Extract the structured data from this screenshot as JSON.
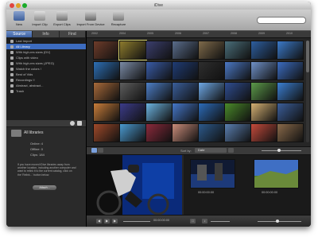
{
  "window": {
    "title": "iDive"
  },
  "toolbar": {
    "buttons": [
      {
        "label": "New"
      },
      {
        "label": "Import Clip"
      },
      {
        "label": "Export Clips"
      },
      {
        "label": "Import From Device"
      },
      {
        "label": "Recapture"
      }
    ],
    "search_placeholder": ""
  },
  "sidebar": {
    "tabs": [
      {
        "label": "Source"
      },
      {
        "label": "Info"
      },
      {
        "label": "Find"
      }
    ],
    "items": [
      {
        "label": "Last Import"
      },
      {
        "label": "All Library"
      },
      {
        "label": "With high-res sizes (DV)"
      },
      {
        "label": "Clips with video"
      },
      {
        "label": "With high-res sizes (JPEG)"
      },
      {
        "label": "Watch the colors !"
      },
      {
        "label": "Best of Vids"
      },
      {
        "label": "Recordings !!"
      },
      {
        "label": "Abstract, abstract..."
      },
      {
        "label": "Trash"
      }
    ],
    "info": {
      "title": "All libraries",
      "stats": [
        "Online: 4",
        "Offline: 0",
        "Clips: 184"
      ],
      "description": "If you have moved iDive libraries away from another location, including another computer and want to relink it to the current catalog, click on the 'Relink...' button below.",
      "button": "Attach..."
    }
  },
  "main": {
    "ruler_ticks": [
      "2002",
      "2004",
      "2005",
      "2006",
      "2007",
      "2008",
      "2009",
      "2010"
    ],
    "sort_label": "Sort by:",
    "sort_value": "Date",
    "timecodes": [
      "00:00:00:00",
      "00:00:00:00"
    ],
    "player_timecode": "00:00:00:00"
  },
  "thumb_colors": [
    "#6e3c2a",
    "#8d7b2d",
    "#3b3f6e",
    "#5a6d8c",
    "#7e6a4a",
    "#4a6e7a",
    "#2d5ea0",
    "#3b7ac9",
    "#2d6fb5",
    "#7a8aa5",
    "#395ca8",
    "#1f3c75",
    "#2e2e2e",
    "#4b78c4",
    "#6f91c8",
    "#3b6cc0",
    "#a86a3a",
    "#5e5e5e",
    "#4d7fc6",
    "#3a5e9a",
    "#6ea8e6",
    "#2f4d91",
    "#5c9a4a",
    "#3b7fd1",
    "#c87d3a",
    "#3c3c8a",
    "#6cb3e0",
    "#4577c8",
    "#2c6bb8",
    "#4a8a2a",
    "#d4b073",
    "#3b5e9a",
    "#a04a2a",
    "#4b9ad0",
    "#8c2a3c",
    "#c98c7a",
    "#2d5a8c",
    "#5a7fb0",
    "#c44b3c",
    "#8a6a4a"
  ]
}
